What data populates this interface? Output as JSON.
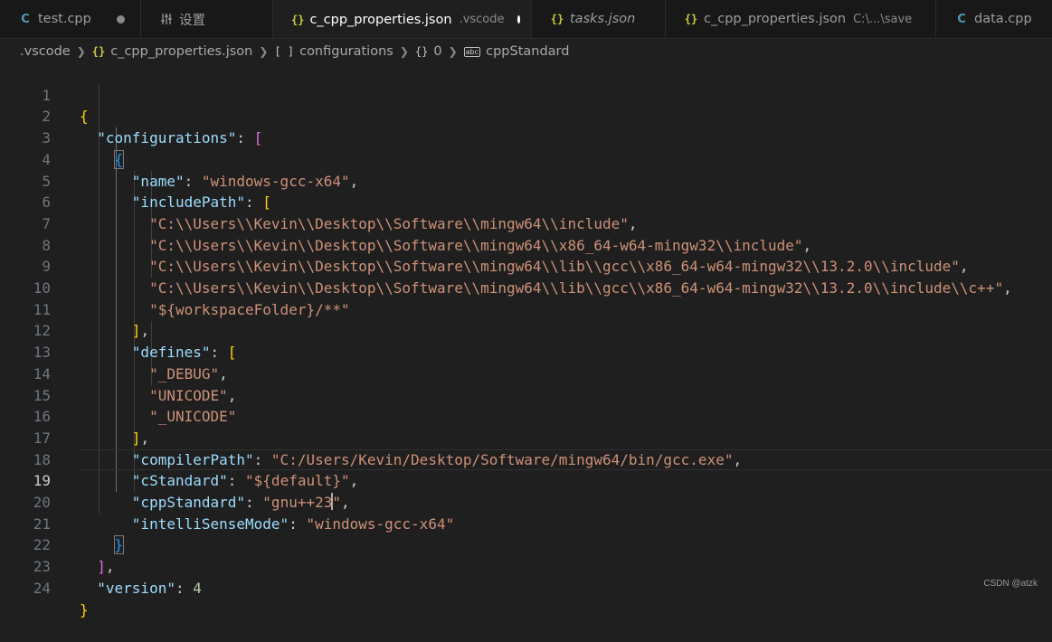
{
  "tabs": [
    {
      "icon": "C",
      "label": "test.cpp",
      "desc": "",
      "dirty": true,
      "active": false,
      "italic": false
    },
    {
      "icon": "settings",
      "label": "设置",
      "desc": "",
      "dirty": false,
      "active": false,
      "italic": false
    },
    {
      "icon": "{}",
      "label": "c_cpp_properties.json",
      "desc": ".vscode",
      "dirty": true,
      "active": true,
      "italic": false
    },
    {
      "icon": "{}",
      "label": "tasks.json",
      "desc": "",
      "dirty": false,
      "active": false,
      "italic": true
    },
    {
      "icon": "{}",
      "label": "c_cpp_properties.json",
      "desc": "C:\\...\\save",
      "dirty": false,
      "active": false,
      "italic": false
    },
    {
      "icon": "C",
      "label": "data.cpp",
      "desc": "",
      "dirty": false,
      "active": false,
      "italic": false
    }
  ],
  "breadcrumb": {
    "folder": ".vscode",
    "file": "c_cpp_properties.json",
    "configurations": "configurations",
    "index": "0",
    "property": "cppStandard",
    "icon_json": "{}",
    "icon_array": "[ ]",
    "icon_object": "{}",
    "icon_string": "abc"
  },
  "line_numbers": [
    "1",
    "2",
    "3",
    "4",
    "5",
    "6",
    "7",
    "8",
    "9",
    "10",
    "11",
    "12",
    "13",
    "14",
    "15",
    "16",
    "17",
    "18",
    "19",
    "20",
    "21",
    "22",
    "23",
    "24"
  ],
  "code": {
    "open_brace": "{",
    "close_brace": "}",
    "open_bracket": "[",
    "close_bracket": "]",
    "colon": ": ",
    "comma": ",",
    "configurations_key": "\"configurations\"",
    "name_key": "\"name\"",
    "name_value": "\"windows-gcc-x64\"",
    "includePath_key": "\"includePath\"",
    "include_paths": [
      "\"C:\\\\Users\\\\Kevin\\\\Desktop\\\\Software\\\\mingw64\\\\include\"",
      "\"C:\\\\Users\\\\Kevin\\\\Desktop\\\\Software\\\\mingw64\\\\x86_64-w64-mingw32\\\\include\"",
      "\"C:\\\\Users\\\\Kevin\\\\Desktop\\\\Software\\\\mingw64\\\\lib\\\\gcc\\\\x86_64-w64-mingw32\\\\13.2.0\\\\include\"",
      "\"C:\\\\Users\\\\Kevin\\\\Desktop\\\\Software\\\\mingw64\\\\lib\\\\gcc\\\\x86_64-w64-mingw32\\\\13.2.0\\\\include\\\\c++\"",
      "\"${workspaceFolder}/**\""
    ],
    "defines_key": "\"defines\"",
    "defines": [
      "\"_DEBUG\"",
      "\"UNICODE\"",
      "\"_UNICODE\""
    ],
    "compilerPath_key": "\"compilerPath\"",
    "compilerPath_value": "\"C:/Users/Kevin/Desktop/Software/mingw64/bin/gcc.exe\"",
    "cStandard_key": "\"cStandard\"",
    "cStandard_value": "\"${default}\"",
    "cppStandard_key": "\"cppStandard\"",
    "cppStandard_value_before_cursor": "\"gnu++23",
    "cppStandard_value_after_cursor": "\"",
    "intelliSenseMode_key": "\"intelliSenseMode\"",
    "intelliSenseMode_value": "\"windows-gcc-x64\"",
    "version_key": "\"version\"",
    "version_value": "4"
  },
  "watermark": "CSDN @atzk",
  "colors": {
    "editor_bg": "#1f1f1f",
    "key": "#9cdcfe",
    "string": "#ce9178",
    "number": "#b5cea8",
    "bracket_level1": "#ffd700",
    "bracket_level2": "#da70d6",
    "bracket_level3": "#179fff",
    "json_icon": "#cbcb41",
    "cpp_icon": "#519aba"
  }
}
